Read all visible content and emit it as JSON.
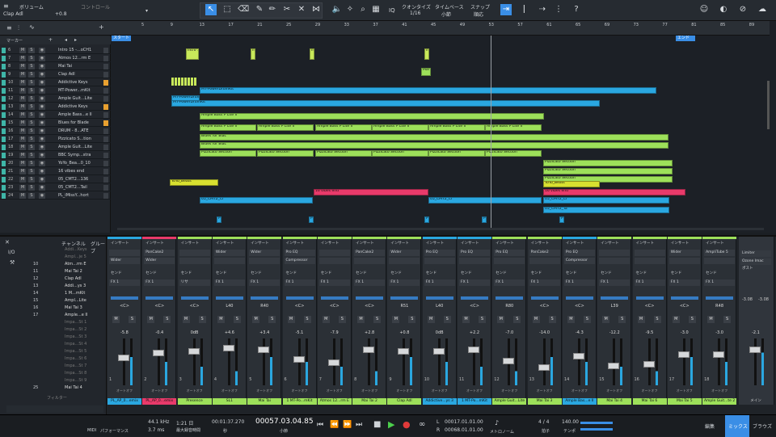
{
  "topbar": {
    "volume_label": "ボリューム",
    "track_name": "Clap Adl",
    "volume_value": "+0.8",
    "control_label": "コントロール",
    "quantize_label": "クオンタイズ",
    "quantize_value": "1/16",
    "timebase_label": "タイムベース",
    "timebase_value": "小節",
    "snap_label": "スナップ",
    "snap_value": "順応"
  },
  "tracklist": {
    "marker_label": "マーカー",
    "tracks": [
      {
        "n": "6",
        "name": "Intro 15 -...oCH1",
        "color": "#3fb6a8"
      },
      {
        "n": "7",
        "name": "Atmos 12...rm E",
        "color": "#3fb6a8"
      },
      {
        "n": "8",
        "name": "Mai Tai",
        "color": "#3fb6a8"
      },
      {
        "n": "9",
        "name": "Clap Adl",
        "color": "#3fb6a8"
      },
      {
        "n": "10",
        "name": "Addictive Keys",
        "color": "#3fb6a8"
      },
      {
        "n": "11",
        "name": "MT-Power...mKit",
        "color": "#3fb6a8"
      },
      {
        "n": "12",
        "name": "Ample Guit...Lite",
        "color": "#3fb6a8"
      },
      {
        "n": "13",
        "name": "Addictive Keys",
        "color": "#3fb6a8"
      },
      {
        "n": "14",
        "name": "Ample Bass...e II",
        "color": "#3fb6a8"
      },
      {
        "n": "15",
        "name": "Blues for Blade",
        "color": "#3fb6a8"
      },
      {
        "n": "16",
        "name": "DRUM - 8...ATE",
        "color": "#3fb6a8"
      },
      {
        "n": "17",
        "name": "Pizzicato S...tion",
        "color": "#3fb6a8"
      },
      {
        "n": "18",
        "name": "Ample Guit...Lite",
        "color": "#3fb6a8"
      },
      {
        "n": "19",
        "name": "BBC Symp...stra",
        "color": "#3fb6a8"
      },
      {
        "n": "20",
        "name": "YoYo_Bea...0_10",
        "color": "#3fb6a8"
      },
      {
        "n": "21",
        "name": "16 vibes end",
        "color": "#3fb6a8"
      },
      {
        "n": "22",
        "name": "05_CMT2...136",
        "color": "#3fb6a8"
      },
      {
        "n": "23",
        "name": "05_CMT2...Tail",
        "color": "#3fb6a8"
      },
      {
        "n": "24",
        "name": "PL_iMissY...hort",
        "color": "#3fb6a8"
      }
    ]
  },
  "ruler": {
    "marks": [
      "5",
      "9",
      "13",
      "17",
      "21",
      "25",
      "29",
      "33",
      "37",
      "41",
      "45",
      "49",
      "53",
      "57",
      "61",
      "65",
      "69",
      "73",
      "77",
      "81",
      "85",
      "89",
      "93"
    ],
    "start_label": "スタート",
    "end_label": "エンド"
  },
  "clips": [
    {
      "t": "Intro 1",
      "c": "#c8e85a"
    },
    {
      "t": "MT-PowerDrumKit",
      "c": "#2aa7e0"
    },
    {
      "t": "MT-Power",
      "c": "#2aa7e0"
    },
    {
      "t": "Ample Bass P Lite II",
      "c": "#9de05a"
    },
    {
      "t": "Blues for Blac",
      "c": "#9de05a"
    },
    {
      "t": "Pizzicato Section",
      "c": "#9de05a"
    },
    {
      "t": "YoYo_Beats",
      "c": "#d8e030"
    },
    {
      "t": "16 vibes end",
      "c": "#e83a6a"
    },
    {
      "t": "05_CMT2_Cr",
      "c": "#2aa7e0"
    },
    {
      "t": "05_CMT2_Ta",
      "c": "#2aa7e0"
    },
    {
      "t": "Mai T",
      "c": "#9de05a"
    },
    {
      "t": "PL",
      "c": "#2aa7e0"
    }
  ],
  "mixer": {
    "tab_channel": "チャンネル",
    "tab_group": "グループ",
    "filter_label": "フィルター",
    "io_label": "I/O",
    "list": [
      {
        "n": "",
        "name": "Addi...Keys"
      },
      {
        "n": "",
        "name": "Ampl...je 5"
      },
      {
        "n": "10",
        "name": "Atm...rm E"
      },
      {
        "n": "11",
        "name": "Mai Tai 2"
      },
      {
        "n": "12",
        "name": "Clap Adl"
      },
      {
        "n": "13",
        "name": "Addi...ys 3"
      },
      {
        "n": "14",
        "name": "1 M...mKit"
      },
      {
        "n": "15",
        "name": "Ampl...Lite"
      },
      {
        "n": "16",
        "name": "Mai Tai 3"
      },
      {
        "n": "17",
        "name": "Ample...e II"
      },
      {
        "n": "",
        "name": "Impa...St 1"
      },
      {
        "n": "",
        "name": "Impa...St 2"
      },
      {
        "n": "",
        "name": "Impa...St 3"
      },
      {
        "n": "",
        "name": "Impa...St 4"
      },
      {
        "n": "",
        "name": "Impa...St 5"
      },
      {
        "n": "",
        "name": "Impa...St 6"
      },
      {
        "n": "",
        "name": "Impa...St 7"
      },
      {
        "n": "",
        "name": "Impa...St 8"
      },
      {
        "n": "",
        "name": "Impa...St 9"
      },
      {
        "n": "25",
        "name": "Mai Tai 4"
      }
    ],
    "insert_label": "インサート",
    "send_label": "センド",
    "auto_label": "オートオフ",
    "channels": [
      {
        "name": "PL_AP_0...emix",
        "color": "#2aa7e0",
        "ins1": "",
        "ins2": "Wider",
        "send": "FX 1",
        "pan": "<C>",
        "vol": "-5.8",
        "num": "1",
        "cap": 20
      },
      {
        "name": "PL_AP_0...emix",
        "color": "#e83a6a",
        "ins1": "PanCake2",
        "ins2": "Wider",
        "send": "FX 1",
        "pan": "<C>",
        "vol": "-0.4",
        "num": "2",
        "cap": 14
      },
      {
        "name": "Presence",
        "color": "#9de05a",
        "ins1": "",
        "ins2": "",
        "send": "リサ",
        "pan": "<C>",
        "vol": "0dB",
        "num": "3",
        "cap": 12
      },
      {
        "name": "SL1",
        "color": "#9de05a",
        "ins1": "Wider",
        "ins2": "",
        "send": "FX 1",
        "pan": "L40",
        "vol": "+4.6",
        "num": "4",
        "cap": 8
      },
      {
        "name": "Mai Tai",
        "color": "#9de05a",
        "ins1": "Wider",
        "ins2": "",
        "send": "FX 1",
        "pan": "R40",
        "vol": "+3.4",
        "num": "5",
        "cap": 10
      },
      {
        "name": "1 MT-Po...mKit",
        "color": "#9de05a",
        "ins1": "Pro EQ",
        "ins2": "Compressor",
        "send": "FX 1",
        "pan": "<C>",
        "vol": "-5.1",
        "num": "6",
        "cap": 22
      },
      {
        "name": "Atmos 12...rm E",
        "color": "#9de05a",
        "ins1": "",
        "ins2": "",
        "send": "FX 1",
        "pan": "<C>",
        "vol": "-7.9",
        "num": "7",
        "cap": 26
      },
      {
        "name": "Mai Tai 2",
        "color": "#9de05a",
        "ins1": "PanCake2",
        "ins2": "",
        "send": "FX 1",
        "pan": "<C>",
        "vol": "+2.8",
        "num": "8",
        "cap": 10
      },
      {
        "name": "Clap Adl",
        "color": "#9de05a",
        "ins1": "Wider",
        "ins2": "",
        "send": "FX 1",
        "pan": "R51",
        "vol": "+0.8",
        "num": "9",
        "cap": 12
      },
      {
        "name": "Addictive...ys 3",
        "color": "#2aa7e0",
        "ins1": "Pro EQ",
        "ins2": "",
        "send": "FX 1",
        "pan": "L40",
        "vol": "0dB",
        "num": "10",
        "cap": 12
      },
      {
        "name": "1 MT-Po...mKit",
        "color": "#2aa7e0",
        "ins1": "Pro EQ",
        "ins2": "",
        "send": "FX 1",
        "pan": "<C>",
        "vol": "+2.2",
        "num": "11",
        "cap": 10
      },
      {
        "name": "Ample Guit...Lite",
        "color": "#9de05a",
        "ins1": "Pro EQ",
        "ins2": "",
        "send": "FX 1",
        "pan": "R80",
        "vol": "-7.0",
        "num": "12",
        "cap": 24
      },
      {
        "name": "Mai Tai 3",
        "color": "#9de05a",
        "ins1": "PanCake2",
        "ins2": "",
        "send": "FX 1",
        "pan": "<C>",
        "vol": "-14.0",
        "num": "13",
        "cap": 32
      },
      {
        "name": "Ample Bas...e II",
        "color": "#2aa7e0",
        "ins1": "Pro EQ",
        "ins2": "Compressor",
        "send": "FX 1",
        "pan": "<C>",
        "vol": "-4.3",
        "num": "14",
        "cap": 18
      },
      {
        "name": "Mai Tai 4",
        "color": "#9de05a",
        "ins1": "",
        "ins2": "",
        "send": "FX 1",
        "pan": "L39",
        "vol": "-12.2",
        "num": "15",
        "cap": 30
      },
      {
        "name": "Mai Tai 6",
        "color": "#9de05a",
        "ins1": "",
        "ins2": "",
        "send": "FX 1",
        "pan": "<C>",
        "vol": "-9.5",
        "num": "16",
        "cap": 28
      },
      {
        "name": "Mai Tai 5",
        "color": "#9de05a",
        "ins1": "Wider",
        "ins2": "",
        "send": "FX 1",
        "pan": "<C>",
        "vol": "-3.0",
        "num": "17",
        "cap": 16
      },
      {
        "name": "Ample Guit...te 2",
        "color": "#9de05a",
        "ins1": "AmpliTube 5",
        "ins2": "",
        "send": "FX 1",
        "pan": "R48",
        "vol": "-3.0",
        "num": "18",
        "cap": 16
      }
    ],
    "main": {
      "name": "メイン",
      "ins1": "Limiter",
      "ins2": "Ozone Imac",
      "post": "ポスト",
      "vol": "-2.1",
      "peak_l": "-3.08",
      "peak_r": "-3.08"
    }
  },
  "transport": {
    "midi": "MIDI",
    "performance": "パフォーマンス",
    "sample_rate": "44.1 kHz",
    "latency": "3.7 ms",
    "record_time": "1:21 日",
    "record_max": "最大録音時間",
    "time_seconds": "00:01:37.270",
    "sec_label": "秒",
    "position": "00057.03.04.85",
    "bar_label": "小節",
    "loop_l": "00017.01.01.00",
    "loop_r": "00068.01.01.00",
    "metronome": "メトロノーム",
    "time_sig": "4 / 4",
    "tempo": "140.00",
    "beat_label": "拍子",
    "tempo_label": "テンポ",
    "edit_btn": "編集",
    "mix_btn": "ミックス",
    "browse_btn": "ブラウズ"
  }
}
